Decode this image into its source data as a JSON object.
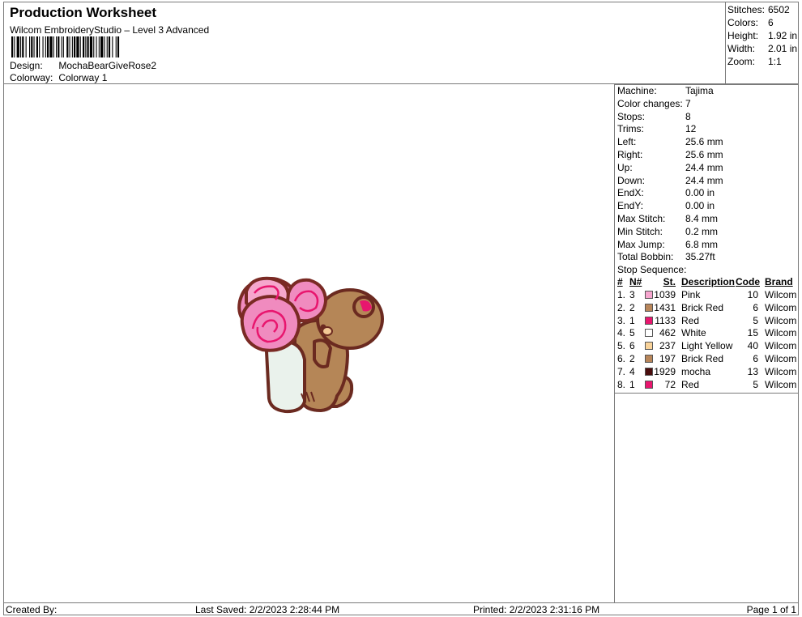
{
  "header": {
    "title": "Production Worksheet",
    "subtitle": "Wilcom EmbroideryStudio – Level 3 Advanced",
    "design_label": "Design:",
    "design_value": "MochaBearGiveRose2",
    "colorway_label": "Colorway:",
    "colorway_value": "Colorway 1"
  },
  "summary": [
    {
      "label": "Stitches:",
      "value": "6502"
    },
    {
      "label": "Colors:",
      "value": "6"
    },
    {
      "label": "Height:",
      "value": "1.92 in"
    },
    {
      "label": "Width:",
      "value": "2.01 in"
    },
    {
      "label": "Zoom:",
      "value": "1:1"
    }
  ],
  "info": [
    {
      "label": "Machine:",
      "value": "Tajima"
    },
    {
      "label": "Color changes:",
      "value": "7"
    },
    {
      "label": "Stops:",
      "value": "8"
    },
    {
      "label": "Trims:",
      "value": "12"
    },
    {
      "label": "Left:",
      "value": "25.6 mm"
    },
    {
      "label": "Right:",
      "value": "25.6 mm"
    },
    {
      "label": "Up:",
      "value": "24.4 mm"
    },
    {
      "label": "Down:",
      "value": "24.4 mm"
    },
    {
      "label": "EndX:",
      "value": "0.00 in"
    },
    {
      "label": "EndY:",
      "value": "0.00 in"
    },
    {
      "label": "Max Stitch:",
      "value": "8.4 mm"
    },
    {
      "label": "Min Stitch:",
      "value": "0.2 mm"
    },
    {
      "label": "Max Jump:",
      "value": "6.8 mm"
    },
    {
      "label": "Total Bobbin:",
      "value": "35.27ft"
    }
  ],
  "stop_sequence": {
    "label": "Stop Sequence:",
    "columns": [
      "#",
      "N#",
      "St.",
      "Description",
      "Code",
      "Brand"
    ],
    "rows": [
      {
        "num": "1.",
        "n": "3",
        "color": "#f7a6cf",
        "st": "1039",
        "desc": "Pink",
        "code": "10",
        "brand": "Wilcom"
      },
      {
        "num": "2.",
        "n": "2",
        "color": "#b8865a",
        "st": "1431",
        "desc": "Brick Red",
        "code": "6",
        "brand": "Wilcom"
      },
      {
        "num": "3.",
        "n": "1",
        "color": "#e8166e",
        "st": "1133",
        "desc": "Red",
        "code": "5",
        "brand": "Wilcom"
      },
      {
        "num": "4.",
        "n": "5",
        "color": "#ffffff",
        "st": "462",
        "desc": "White",
        "code": "15",
        "brand": "Wilcom"
      },
      {
        "num": "5.",
        "n": "6",
        "color": "#f9d39a",
        "st": "237",
        "desc": "Light Yellow",
        "code": "40",
        "brand": "Wilcom"
      },
      {
        "num": "6.",
        "n": "2",
        "color": "#b8865a",
        "st": "197",
        "desc": "Brick Red",
        "code": "6",
        "brand": "Wilcom"
      },
      {
        "num": "7.",
        "n": "4",
        "color": "#4a0d0d",
        "st": "1929",
        "desc": "mocha",
        "code": "13",
        "brand": "Wilcom"
      },
      {
        "num": "8.",
        "n": "1",
        "color": "#e8166e",
        "st": "72",
        "desc": "Red",
        "code": "5",
        "brand": "Wilcom"
      }
    ]
  },
  "footer": {
    "created_by": "Created By:",
    "last_saved": "Last Saved: 2/2/2023 2:28:44 PM",
    "printed": "Printed: 2/2/2023 2:31:16 PM",
    "page": "Page 1 of 1"
  }
}
